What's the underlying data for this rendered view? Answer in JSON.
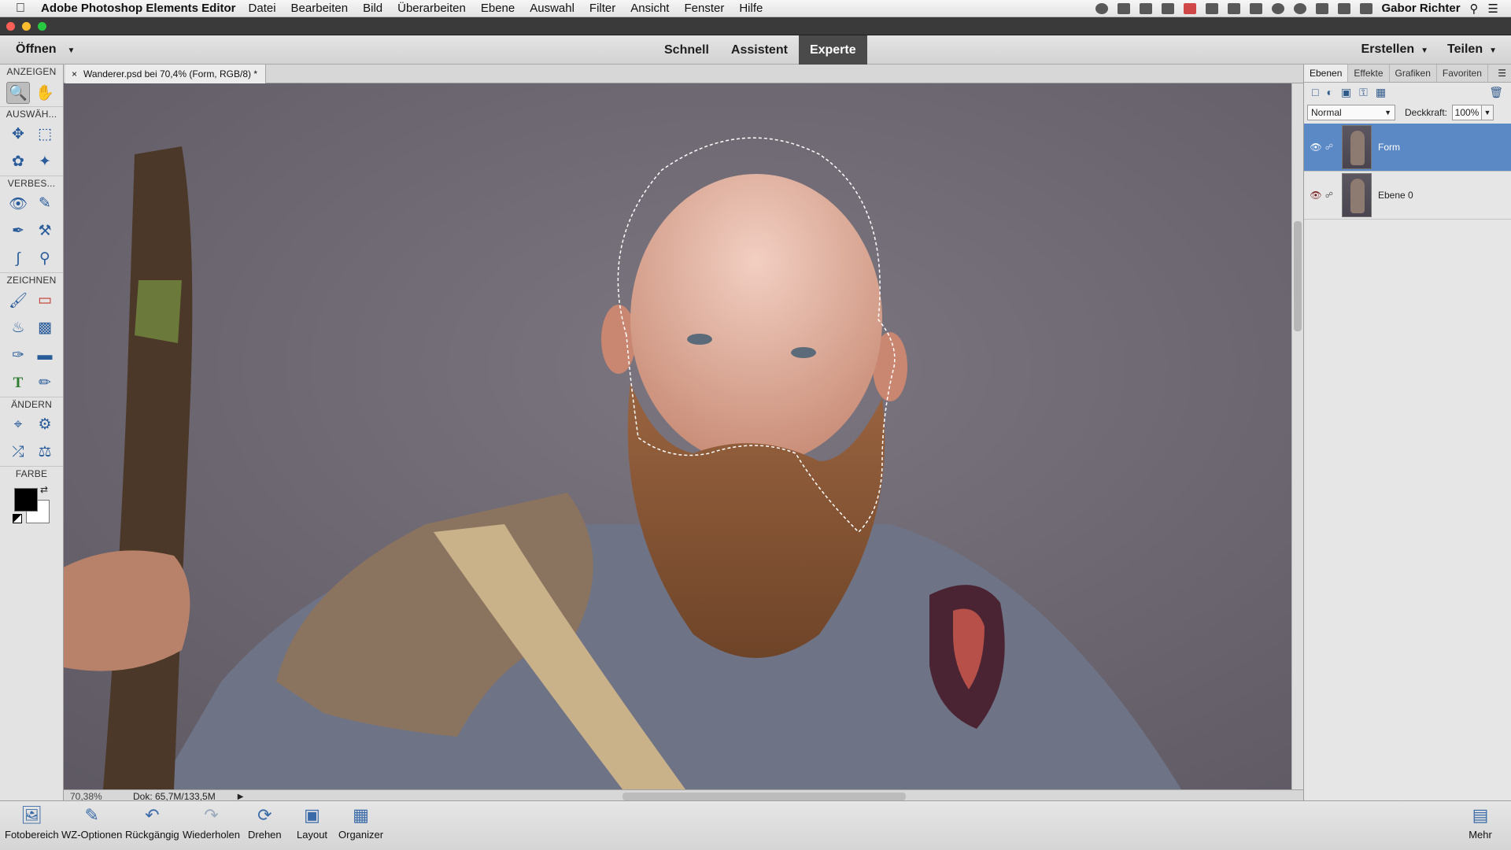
{
  "menubar": {
    "app_name": "Adobe Photoshop Elements Editor",
    "items": [
      "Datei",
      "Bearbeiten",
      "Bild",
      "Überarbeiten",
      "Ebene",
      "Auswahl",
      "Filter",
      "Ansicht",
      "Fenster",
      "Hilfe"
    ],
    "user": "Gabor Richter"
  },
  "header": {
    "open_label": "Öffnen",
    "modes": [
      "Schnell",
      "Assistent",
      "Experte"
    ],
    "active_mode": "Experte",
    "create_label": "Erstellen",
    "share_label": "Teilen"
  },
  "toolpanel": {
    "sections": [
      "ANZEIGEN",
      "AUSWÄH...",
      "VERBES...",
      "ZEICHNEN",
      "ÄNDERN",
      "FARBE"
    ]
  },
  "document": {
    "tab_label": "Wanderer.psd bei 70,4% (Form, RGB/8) *",
    "close_glyph": "×",
    "zoom": "70,38%",
    "doc_info": "Dok: 65,7M/133,5M"
  },
  "layers_panel": {
    "tabs": [
      "Ebenen",
      "Effekte",
      "Grafiken",
      "Favoriten"
    ],
    "blend_mode": "Normal",
    "opacity_label": "Deckkraft:",
    "opacity_value": "100%",
    "layers": [
      {
        "name": "Form",
        "visible": true,
        "selected": true
      },
      {
        "name": "Ebene 0",
        "visible": false,
        "selected": false
      }
    ]
  },
  "bottombar": {
    "buttons": [
      "Fotobereich",
      "WZ-Optionen",
      "Rückgängig",
      "Wiederholen",
      "Drehen",
      "Layout",
      "Organizer"
    ],
    "more_label": "Mehr"
  },
  "colors": {
    "accent": "#5b89c6",
    "active_mode_bg": "#4a4a4a",
    "canvas_bg": "#6b6670"
  }
}
